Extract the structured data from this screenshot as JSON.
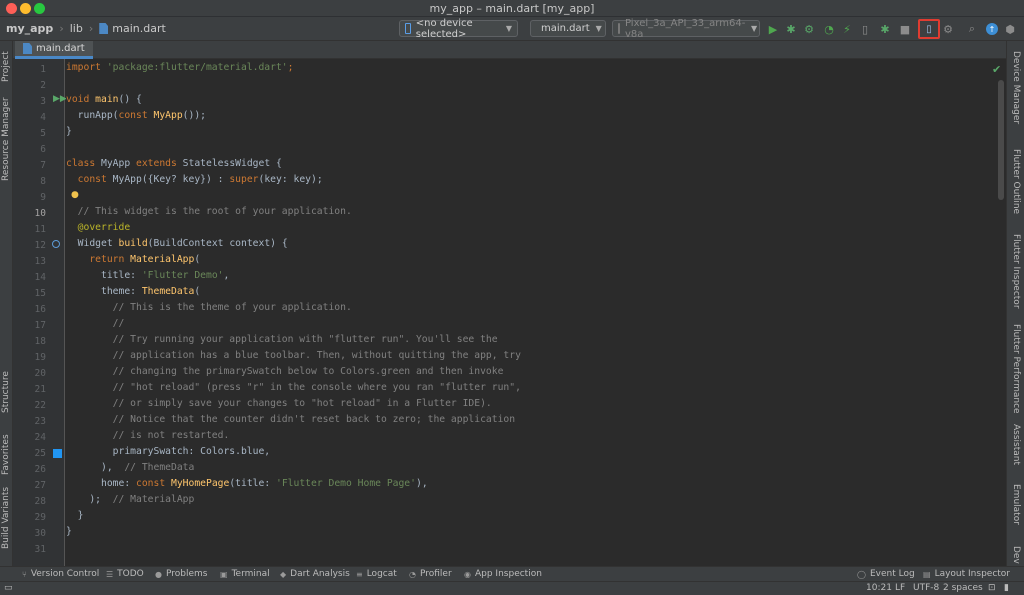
{
  "window": {
    "title": "my_app – main.dart [my_app]"
  },
  "breadcrumbs": [
    "my_app",
    "lib",
    "main.dart"
  ],
  "toolbar": {
    "device_selector": "<no device selected>",
    "run_config": "main.dart",
    "emulator": "Pixel_3a_API_33_arm64-v8a"
  },
  "editor_tab": "main.dart",
  "left_tools": [
    "Project",
    "Resource Manager",
    "Structure",
    "Favorites",
    "Build Variants"
  ],
  "right_tools": [
    "Device Manager",
    "Flutter Outline",
    "Flutter Inspector",
    "Flutter Performance",
    "Assistant",
    "Emulator",
    "Dev"
  ],
  "code_lines": [
    "1",
    "2",
    "3",
    "4",
    "5",
    "6",
    "7",
    "8",
    "9",
    "10",
    "11",
    "12",
    "13",
    "14",
    "15",
    "16",
    "17",
    "18",
    "19",
    "20",
    "21",
    "22",
    "23",
    "24",
    "25",
    "26",
    "27",
    "28",
    "29",
    "30",
    "31"
  ],
  "code": {
    "l1a": "import ",
    "l1b": "'package:flutter/material.dart'",
    "l1c": ";",
    "l3a": "void ",
    "l3b": "main",
    "l3c": "() {",
    "l4a": "  runApp(",
    "l4b": "const ",
    "l4c": "MyApp",
    "l4d": "());",
    "l5": "}",
    "l7a": "class ",
    "l7b": "MyApp ",
    "l7c": "extends ",
    "l7d": "StatelessWidget {",
    "l8a": "  ",
    "l8b": "const ",
    "l8c": "MyApp({Key? key}) : ",
    "l8d": "super",
    "l8e": "(key: key);",
    "l10": "  // This widget is the root of your application.",
    "l11": "  @override",
    "l12a": "  Widget ",
    "l12b": "build",
    "l12c": "(BuildContext context) {",
    "l13a": "    ",
    "l13b": "return ",
    "l13c": "MaterialApp",
    "l13d": "(",
    "l14a": "      title: ",
    "l14b": "'Flutter Demo'",
    "l14c": ",",
    "l15a": "      theme: ",
    "l15b": "ThemeData",
    "l15c": "(",
    "l16": "        // This is the theme of your application.",
    "l17": "        //",
    "l18": "        // Try running your application with \"flutter run\". You'll see the",
    "l19": "        // application has a blue toolbar. Then, without quitting the app, try",
    "l20": "        // changing the primarySwatch below to Colors.green and then invoke",
    "l21": "        // \"hot reload\" (press \"r\" in the console where you ran \"flutter run\",",
    "l22": "        // or simply save your changes to \"hot reload\" in a Flutter IDE).",
    "l23": "        // Notice that the counter didn't reset back to zero; the application",
    "l24": "        // is not restarted.",
    "l25": "        primarySwatch: Colors.blue,",
    "l26a": "      ),  ",
    "l26b": "// ThemeData",
    "l27a": "      home: ",
    "l27b": "const ",
    "l27c": "MyHomePage",
    "l27d": "(title: ",
    "l27e": "'Flutter Demo Home Page'",
    "l27f": "),",
    "l28a": "    );  ",
    "l28b": "// MaterialApp",
    "l29": "  }",
    "l30": "}"
  },
  "bottom_tools": [
    "Version Control",
    "TODO",
    "Problems",
    "Terminal",
    "Dart Analysis",
    "Logcat",
    "Profiler",
    "App Inspection",
    "Event Log",
    "Layout Inspector"
  ],
  "status": {
    "position": "10:21",
    "line_sep": "LF",
    "encoding": "UTF-8",
    "indent": "2 spaces"
  },
  "colors": {
    "keyword": "#cc7832",
    "string": "#6a8759",
    "function": "#ffc66d",
    "comment": "#808080",
    "highlight": "#e03c31"
  }
}
